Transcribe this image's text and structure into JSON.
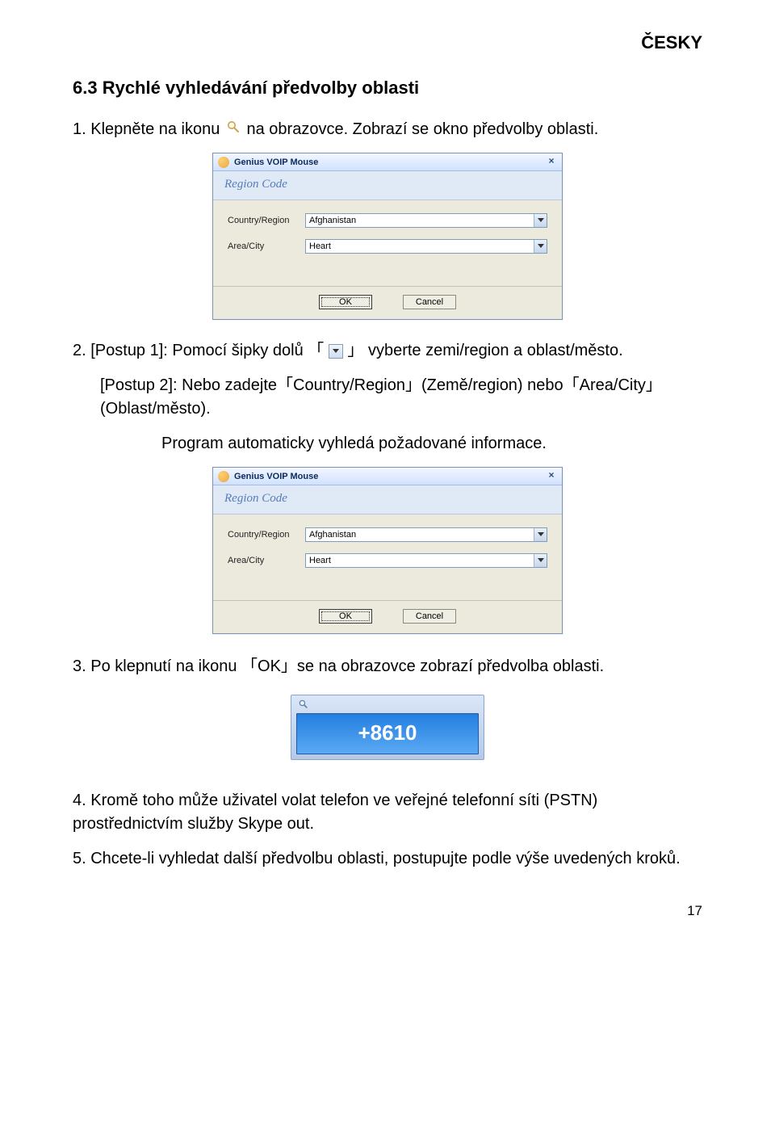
{
  "header": {
    "language": "ČESKY"
  },
  "section": {
    "title": "6.3 Rychlé vyhledávání předvolby oblasti"
  },
  "text": {
    "p1a": "1. Klepněte na ikonu ",
    "p1b": " na obrazovce. Zobrazí se okno předvolby oblasti.",
    "p2a": "2. [Postup 1]: Pomocí šipky dolů ",
    "p2b": " vyberte zemi/region a oblast/město.",
    "p3": "[Postup 2]: Nebo zadejte「Country/Region」(Země/region) nebo「Area/City」(Oblast/město).",
    "p3b": "Program automaticky vyhledá požadované informace.",
    "p4": "3. Po klepnutí na ikonu 「OK」se na obrazovce zobrazí předvolba oblasti.",
    "p5": "4. Kromě toho může uživatel volat telefon ve veřejné telefonní síti (PSTN) prostřednictvím služby Skype out.",
    "p6": "5. Chcete-li vyhledat další předvolbu oblasti, postupujte podle výše uvedených kroků."
  },
  "dialog": {
    "title": "Genius VOIP Mouse",
    "region_label": "Region Code",
    "country_label": "Country/Region",
    "country_value": "Afghanistan",
    "area_label": "Area/City",
    "area_value": "Heart",
    "ok": "OK",
    "cancel": "Cancel"
  },
  "phone": {
    "number": "+8610"
  },
  "page": {
    "number": "17"
  }
}
